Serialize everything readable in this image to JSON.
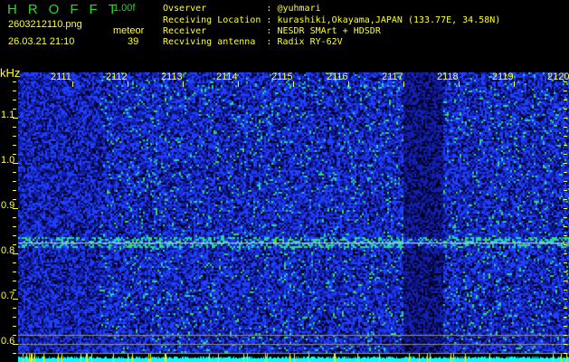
{
  "header": {
    "app_title": "HROFFT",
    "version": "1.00f",
    "filename": "2603212110.png",
    "datetime": "26.03.21 21:10",
    "mode_label": "meteor",
    "count": "39"
  },
  "info": [
    {
      "label": "Ovserver          ",
      "value": ": @yuhmari"
    },
    {
      "label": "Receiving Location",
      "value": ": kurashiki,Okayama,JAPAN (133.77E, 34.58N)"
    },
    {
      "label": "Receiver          ",
      "value": ": NESDR SMArt + HDSDR"
    },
    {
      "label": "Recviving antenna ",
      "value": ": Radix RY-62V"
    }
  ],
  "axis": {
    "unit": "kHz",
    "freq_labels": [
      "1.1",
      "1.0",
      "0.9",
      "0.8",
      "0.7",
      "0.6"
    ],
    "time_labels": [
      "2111",
      "2112",
      "2113",
      "2114",
      "2115",
      "2116",
      "2117",
      "2118",
      "2119",
      "2120"
    ]
  },
  "colors": {
    "text": "#ffff33",
    "title": "#22dd22",
    "spectrum": "#00ffff"
  }
}
